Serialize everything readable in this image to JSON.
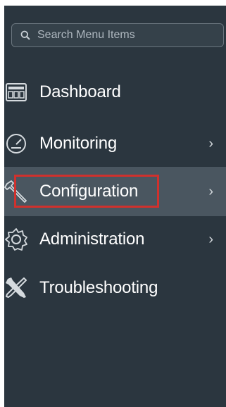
{
  "search": {
    "placeholder": "Search Menu Items",
    "icon": "search-icon"
  },
  "menu": {
    "items": [
      {
        "label": "Dashboard",
        "icon": "dashboard-icon",
        "has_submenu": false,
        "active": false
      },
      {
        "label": "Monitoring",
        "icon": "monitoring-gauge-icon",
        "has_submenu": true,
        "chevron": "›",
        "active": false
      },
      {
        "label": "Configuration",
        "icon": "wrench-icon",
        "has_submenu": true,
        "chevron": "›",
        "active": true,
        "highlighted": true
      },
      {
        "label": "Administration",
        "icon": "gear-icon",
        "has_submenu": true,
        "chevron": "›",
        "active": false
      },
      {
        "label": "Troubleshooting",
        "icon": "tools-icon",
        "has_submenu": false,
        "active": false
      }
    ]
  },
  "colors": {
    "sidebar_bg": "#2b363f",
    "active_bg": "#4a5660",
    "text": "#ffffff",
    "highlight_border": "#d0312d"
  }
}
